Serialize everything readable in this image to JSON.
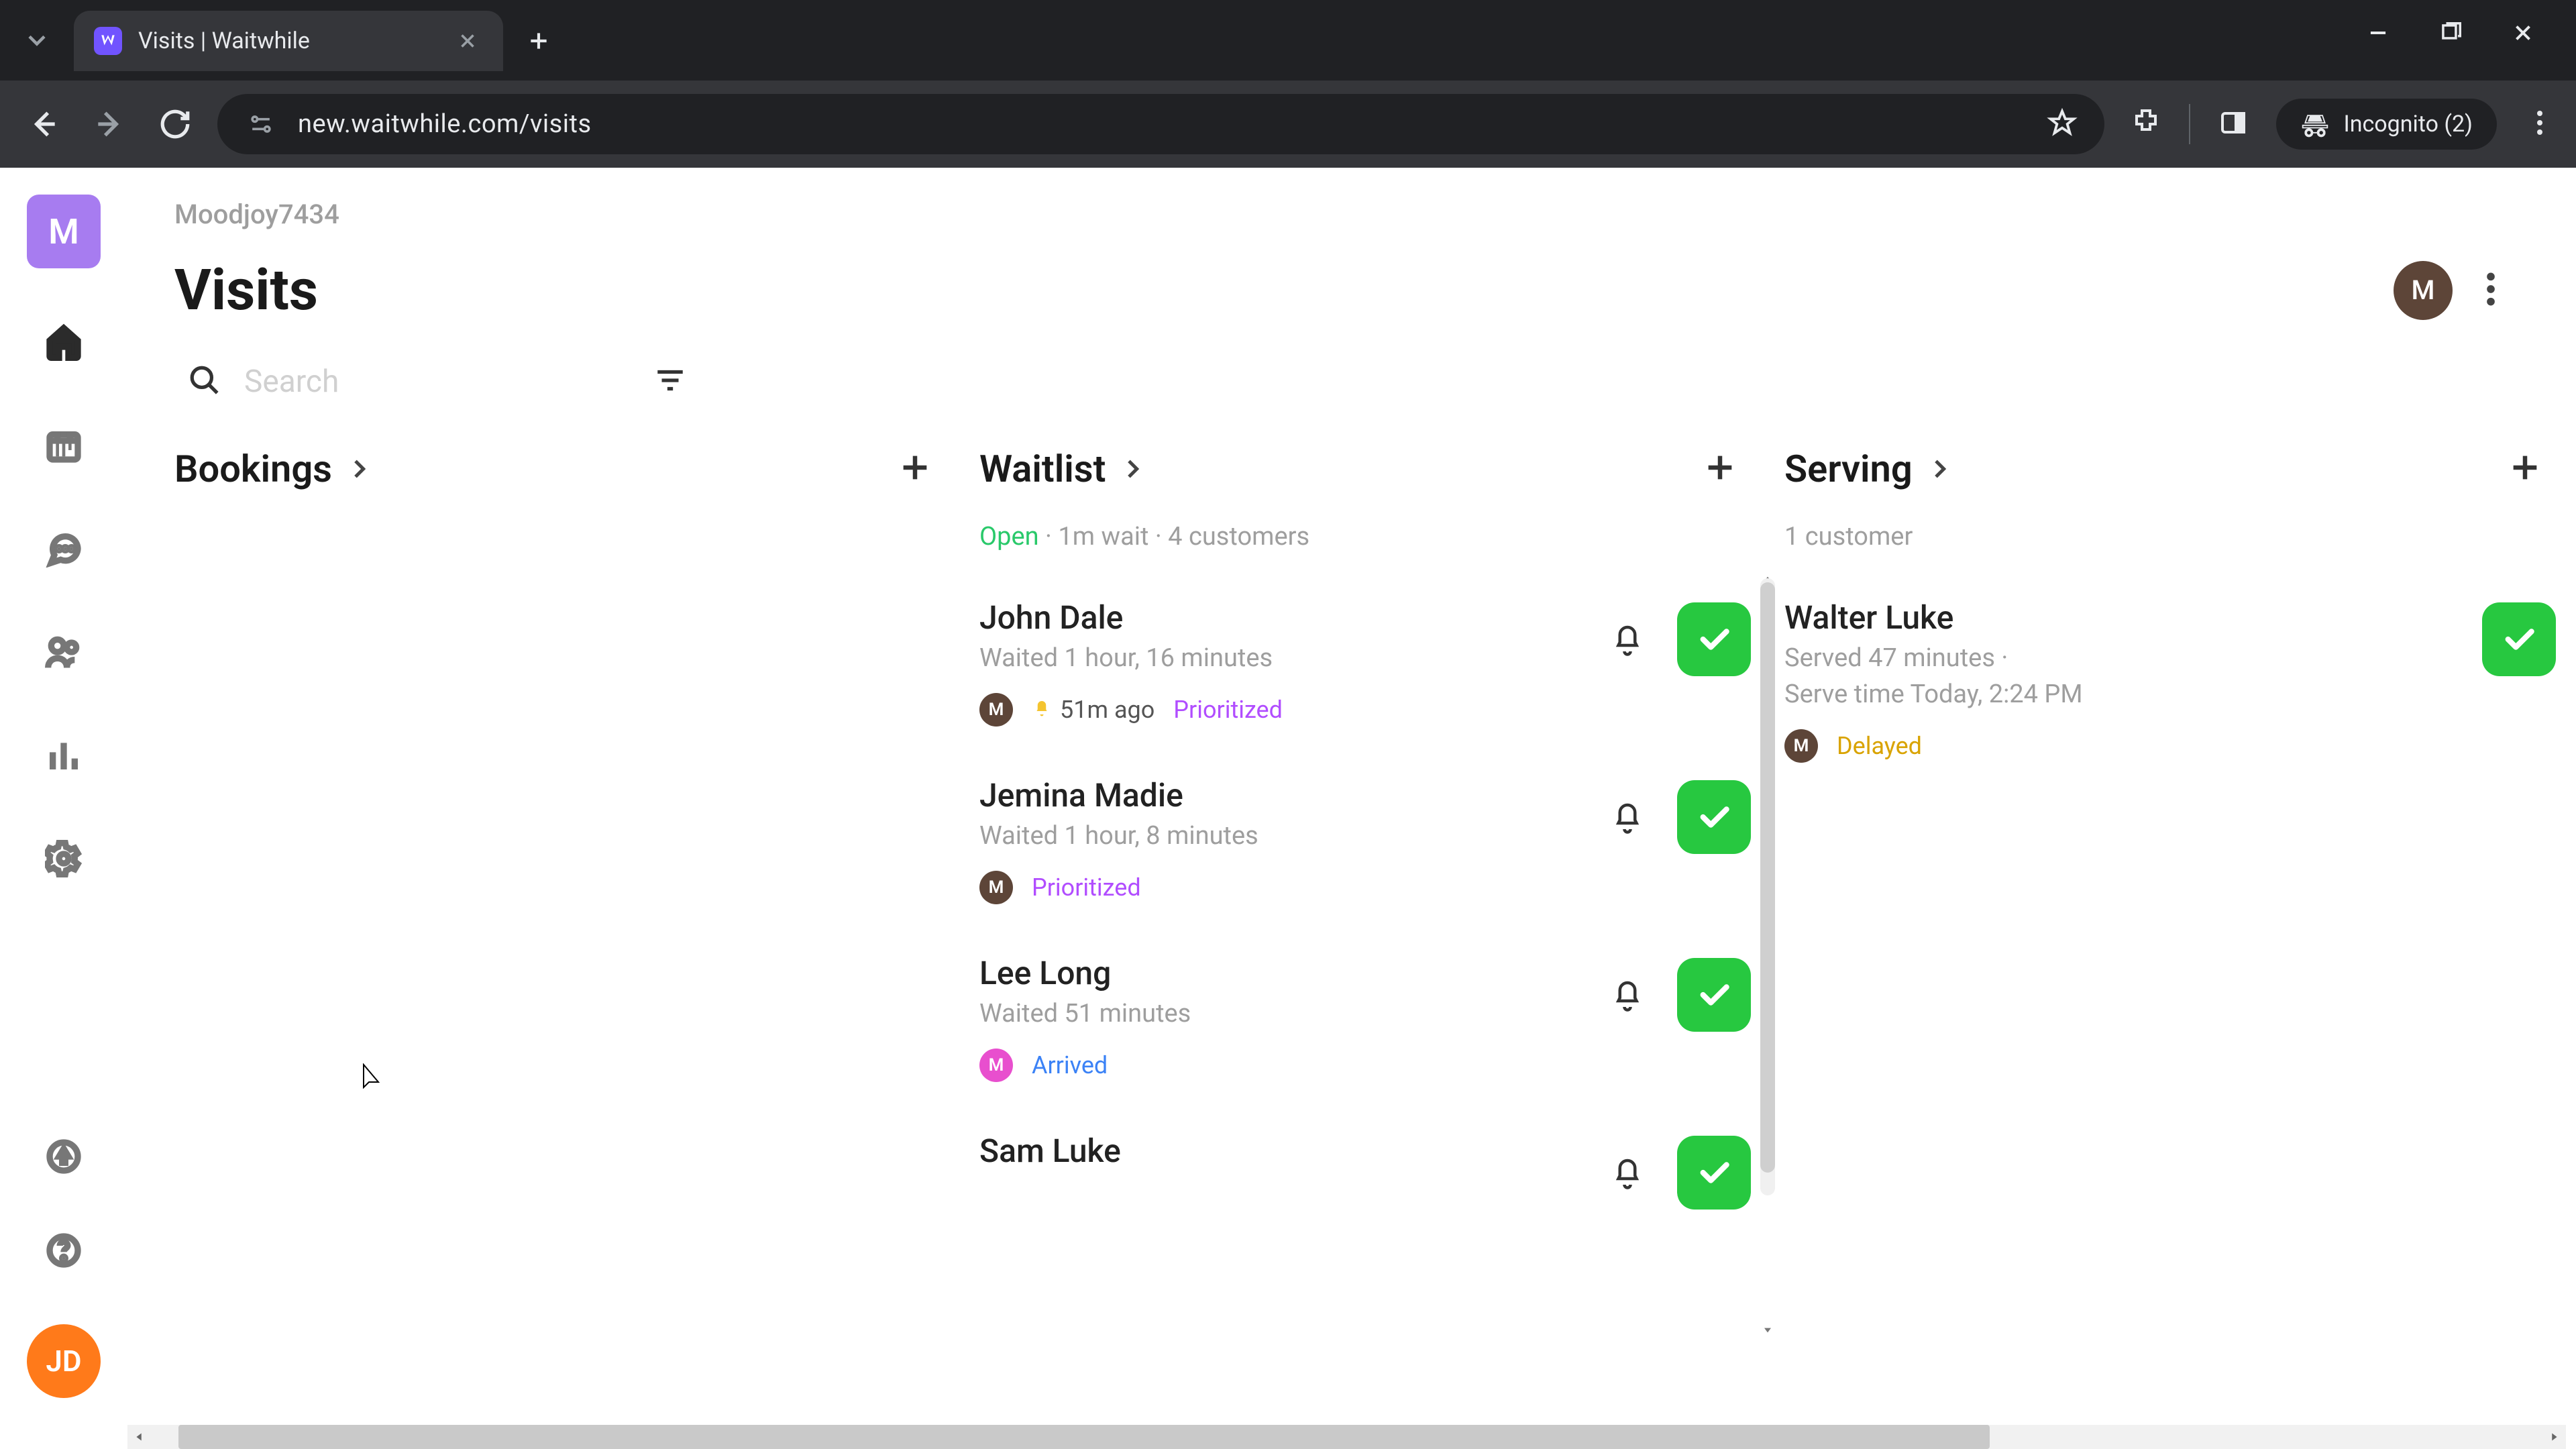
{
  "browser": {
    "tab_title": "Visits | Waitwhile",
    "url": "new.waitwhile.com/visits",
    "incognito_label": "Incognito (2)"
  },
  "workspace": {
    "logo_initial": "M",
    "name": "Moodjoy7434"
  },
  "header": {
    "title": "Visits",
    "avatar_initial": "M"
  },
  "search": {
    "placeholder": "Search"
  },
  "columns": {
    "bookings": {
      "title": "Bookings"
    },
    "waitlist": {
      "title": "Waitlist",
      "status_open": "Open",
      "status_rest": " · 1m wait · 4 customers",
      "items": [
        {
          "name": "John Dale",
          "meta": "Waited 1 hour, 16 minutes",
          "avatar_initial": "M",
          "avatar_color": "brown",
          "ago": "51m ago",
          "show_ago_bell": true,
          "tag": "Prioritized",
          "tag_class": "prioritized",
          "show_notify": true
        },
        {
          "name": "Jemina Madie",
          "meta": "Waited 1 hour, 8 minutes",
          "avatar_initial": "M",
          "avatar_color": "brown",
          "tag": "Prioritized",
          "tag_class": "prioritized",
          "show_notify": true
        },
        {
          "name": "Lee Long",
          "meta": "Waited 51 minutes",
          "avatar_initial": "M",
          "avatar_color": "pink",
          "tag": "Arrived",
          "tag_class": "arrived",
          "show_notify": true
        },
        {
          "name": "Sam Luke",
          "meta": "",
          "show_notify": true
        }
      ]
    },
    "serving": {
      "title": "Serving",
      "status": "1 customer",
      "items": [
        {
          "name": "Walter Luke",
          "meta": "Served 47 minutes ·",
          "meta2": "Serve time Today, 2:24 PM",
          "avatar_initial": "M",
          "avatar_color": "brown",
          "tag": "Delayed",
          "tag_class": "delayed",
          "show_notify": false
        }
      ]
    }
  },
  "leftnav_user_initials": "JD"
}
